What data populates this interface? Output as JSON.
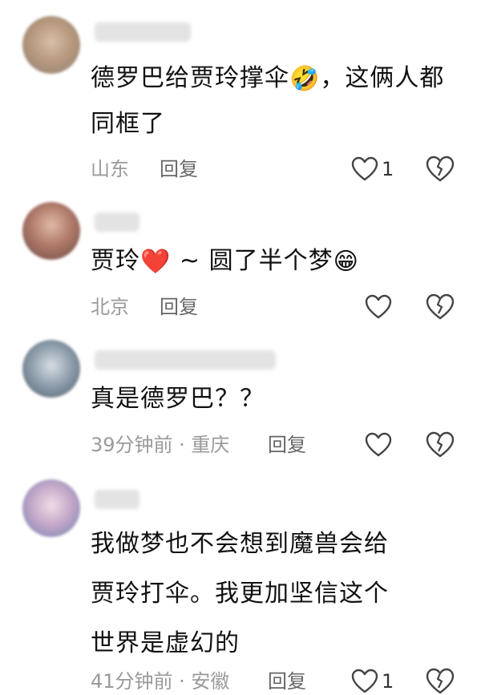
{
  "comments": [
    {
      "text_parts": [
        "德罗巴给贾玲撑伞",
        "，这俩人都同框了"
      ],
      "emoji": "🤣",
      "location": "山东",
      "reply_label": "回复",
      "like_count": "1",
      "avatar_color": "#c9a98a"
    },
    {
      "text_parts": [
        "贾玲",
        " ~ 圆了半个梦"
      ],
      "emoji_heart": "❤️",
      "emoji": "😁",
      "location": "北京",
      "reply_label": "回复",
      "like_count": "",
      "avatar_color": "#b07a6a"
    },
    {
      "text": "真是德罗巴？？",
      "meta": "39分钟前 · 重庆",
      "reply_label": "回复",
      "like_count": "",
      "avatar_color": "#8a9aa8"
    },
    {
      "text_lines": [
        "我做梦也不会想到魔兽会给",
        "贾玲打伞。我更加坚信这个",
        "世界是虚幻的"
      ],
      "meta": "41分钟前 · 安徽",
      "reply_label": "回复",
      "like_count": "1",
      "avatar_color": "#c6a9c9"
    }
  ]
}
